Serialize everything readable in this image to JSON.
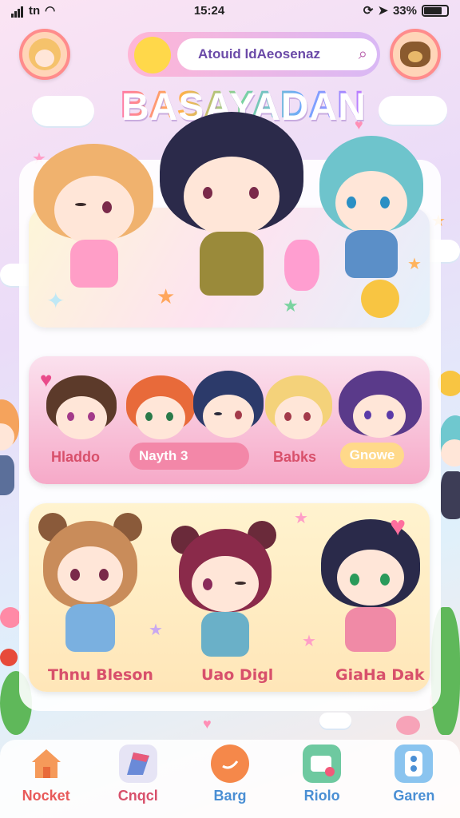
{
  "status_bar": {
    "time": "15:24",
    "carrier": "tn",
    "battery": "33%"
  },
  "header": {
    "search_text": "Atouid ldAeosenaz",
    "logo": "BASAYADAN"
  },
  "pink_card": {
    "label_left": "Hladdo",
    "pill_text": "Nayth 3",
    "label_right": "Babks",
    "button_label": "Gnowe"
  },
  "yellow_card": {
    "caption_1": "Thnu Bleson",
    "caption_2": "Uao Digl",
    "caption_3": "GiaHa Dak"
  },
  "nav": [
    {
      "label": "Nocket",
      "icon": "home-icon",
      "color": "#e85a5a"
    },
    {
      "label": "Cnqcl",
      "icon": "flag-icon",
      "color": "#d8506b"
    },
    {
      "label": "Barg",
      "icon": "chat-icon",
      "color": "#4a8fd4"
    },
    {
      "label": "Riolo",
      "icon": "message-icon",
      "color": "#4a8fd4"
    },
    {
      "label": "Garen",
      "icon": "game-icon",
      "color": "#4a8fd4"
    }
  ],
  "colors": {
    "accent_pink": "#f6a9c8",
    "accent_yellow": "#ffe6b8",
    "accent_purple": "#d9b8f5"
  }
}
